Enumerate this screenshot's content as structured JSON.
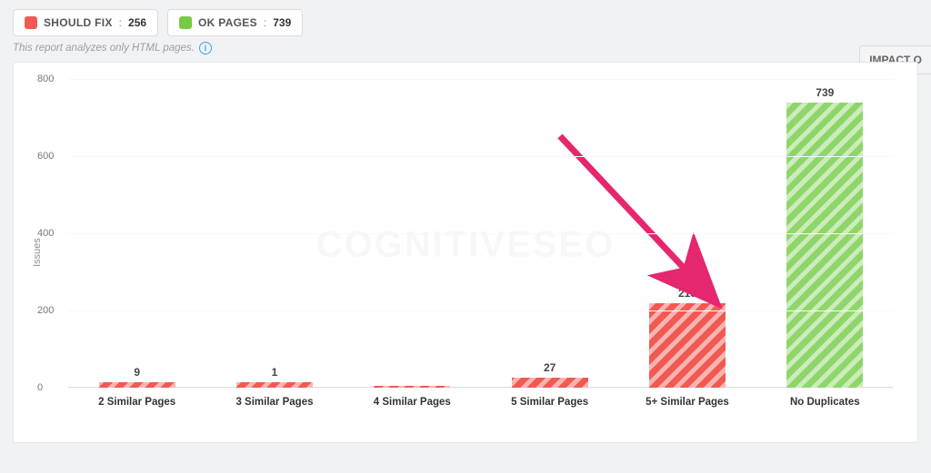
{
  "header": {
    "should_fix_label": "SHOULD FIX",
    "should_fix_count": "256",
    "ok_pages_label": "OK PAGES",
    "ok_pages_count": "739"
  },
  "subnote": "This report analyzes only HTML pages.",
  "impact_button": "IMPACT O",
  "watermark": "COGNITIVESEO",
  "chart_data": {
    "type": "bar",
    "title": "",
    "xlabel": "",
    "ylabel": "Issues",
    "ylim": [
      0,
      800
    ],
    "yticks": [
      0,
      200,
      400,
      600,
      800
    ],
    "categories": [
      "2 Similar Pages",
      "3 Similar Pages",
      "4 Similar Pages",
      "5 Similar Pages",
      "5+ Similar Pages",
      "No Duplicates"
    ],
    "values": [
      9,
      1,
      0,
      27,
      219,
      739
    ],
    "colors": [
      "red",
      "red",
      "red",
      "red",
      "red",
      "green"
    ],
    "annotation_arrow_target_index": 4
  }
}
